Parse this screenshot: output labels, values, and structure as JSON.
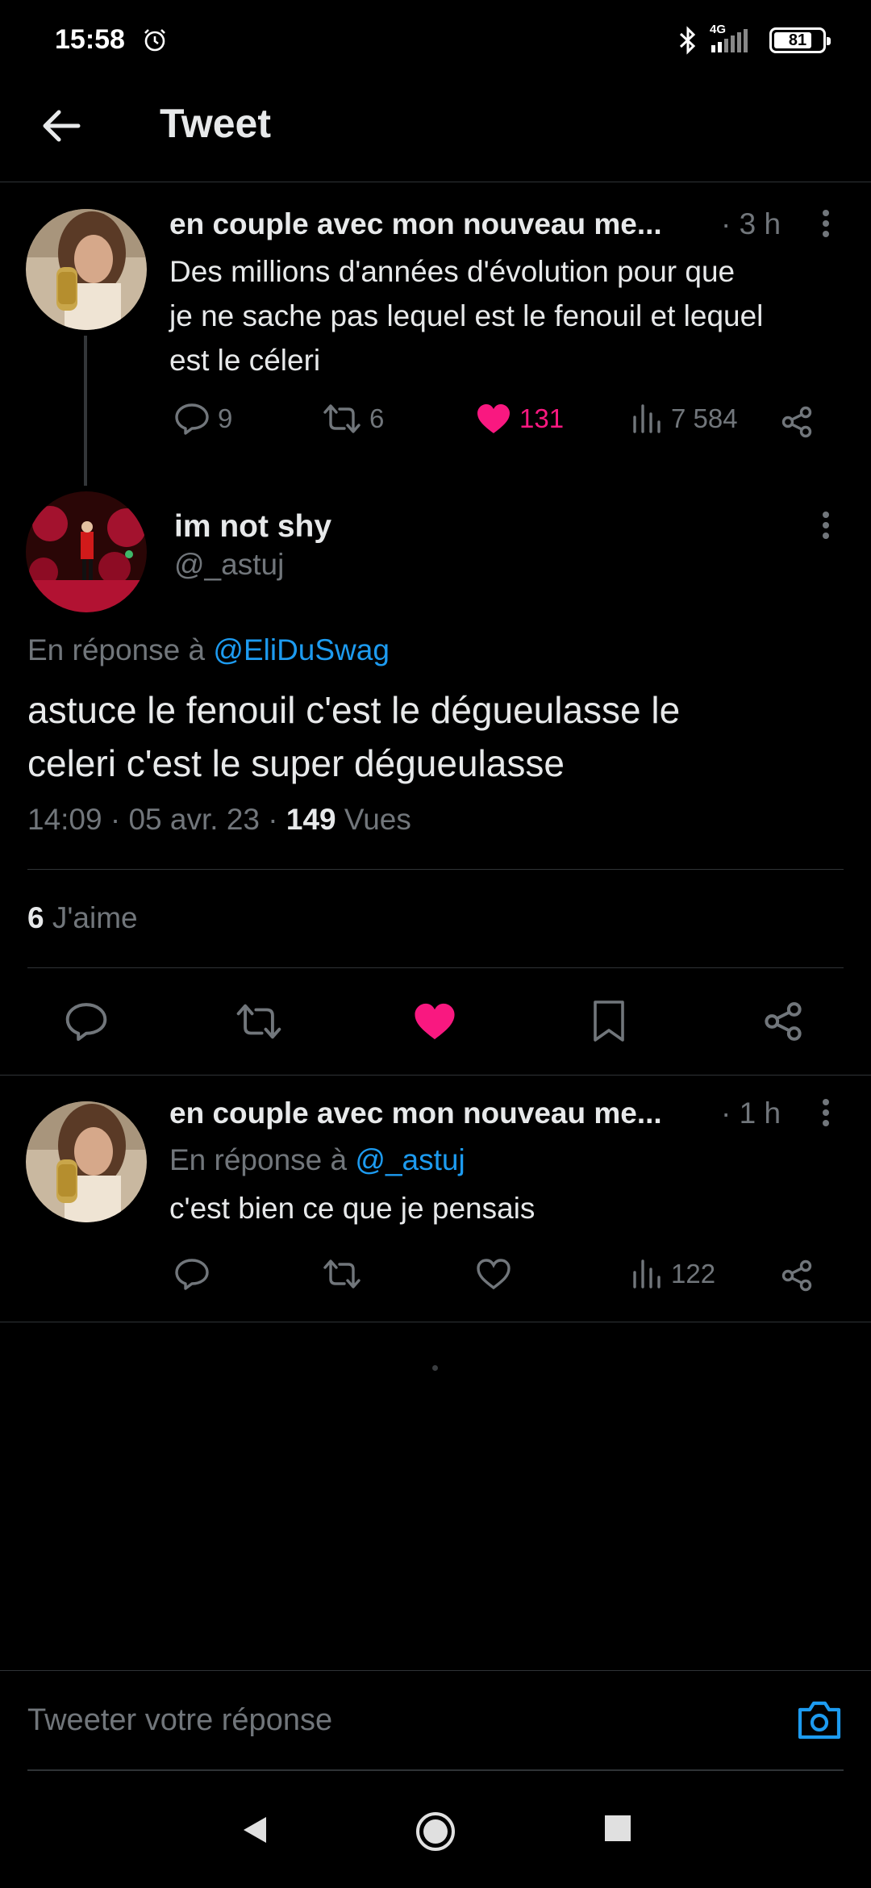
{
  "status_bar": {
    "time": "15:58",
    "network": "4G",
    "battery": "81",
    "battery_level": 0.81
  },
  "header": {
    "title": "Tweet"
  },
  "parent_tweet": {
    "author_name": "en couple avec mon nouveau me...",
    "time": "· 3 h",
    "text_lines": [
      "Des millions d'années d'évolution pour que",
      "je ne sache pas lequel est le fenouil et lequel",
      "est le céleri"
    ],
    "replies": "9",
    "retweets": "6",
    "likes": "131",
    "views": "7 584"
  },
  "main_tweet": {
    "author_name": "im not shy",
    "handle": "@_astuj",
    "reply_to_prefix": "En réponse à",
    "reply_to_handle": "@EliDuSwag",
    "text_lines": [
      "astuce le fenouil c'est le dégueulasse le",
      "celeri c'est le super dégueulasse"
    ],
    "timestamp": "14:09 · 05 avr. 23 ·",
    "views_count": "149",
    "views_label": "Vues",
    "likes_count": "6",
    "likes_label": "J'aime"
  },
  "reply_tweet": {
    "author_name": "en couple avec mon nouveau me...",
    "time": "· 1 h",
    "reply_to_prefix": "En réponse à",
    "reply_to_handle": "@_astuj",
    "text": "c'est bien ce que je pensais",
    "views": "122"
  },
  "reply_bar": {
    "placeholder": "Tweeter votre réponse"
  },
  "colors": {
    "background": "#000000",
    "text": "#e7e9ea",
    "muted": "#71767b",
    "accent": "#1d9bf0",
    "like": "#f91880",
    "divider": "#2f3336"
  },
  "icons": [
    "alarm-icon",
    "bluetooth-icon",
    "signal-icon",
    "battery-icon",
    "back-arrow-icon",
    "more-icon",
    "reply-icon",
    "retweet-icon",
    "heart-icon",
    "views-icon",
    "share-icon",
    "bookmark-icon",
    "camera-icon",
    "nav-back-icon",
    "nav-home-icon",
    "nav-recents-icon"
  ]
}
